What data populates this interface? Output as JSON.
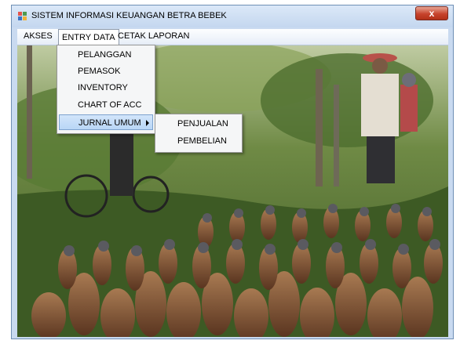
{
  "window": {
    "title": "SISTEM INFORMASI KEUANGAN BETRA BEBEK",
    "close_glyph": "x"
  },
  "menubar": {
    "items": [
      {
        "label": "AKSES"
      },
      {
        "label": "ENTRY DATA"
      },
      {
        "label": "CETAK LAPORAN"
      }
    ]
  },
  "entry_menu": {
    "items": [
      {
        "label": "PELANGGAN"
      },
      {
        "label": "PEMASOK"
      },
      {
        "label": "INVENTORY"
      },
      {
        "label": "CHART OF ACC"
      },
      {
        "label": "JURNAL UMUM"
      }
    ]
  },
  "jurnal_submenu": {
    "items": [
      {
        "label": "PENJUALAN"
      },
      {
        "label": "PEMBELIAN"
      }
    ]
  },
  "background_image": {
    "description_icon": "duck-herd-photo-icon"
  },
  "colors": {
    "title_gradient_top": "#dbe8f8",
    "close_red": "#c7432c",
    "highlight": "#b9d6f6"
  }
}
